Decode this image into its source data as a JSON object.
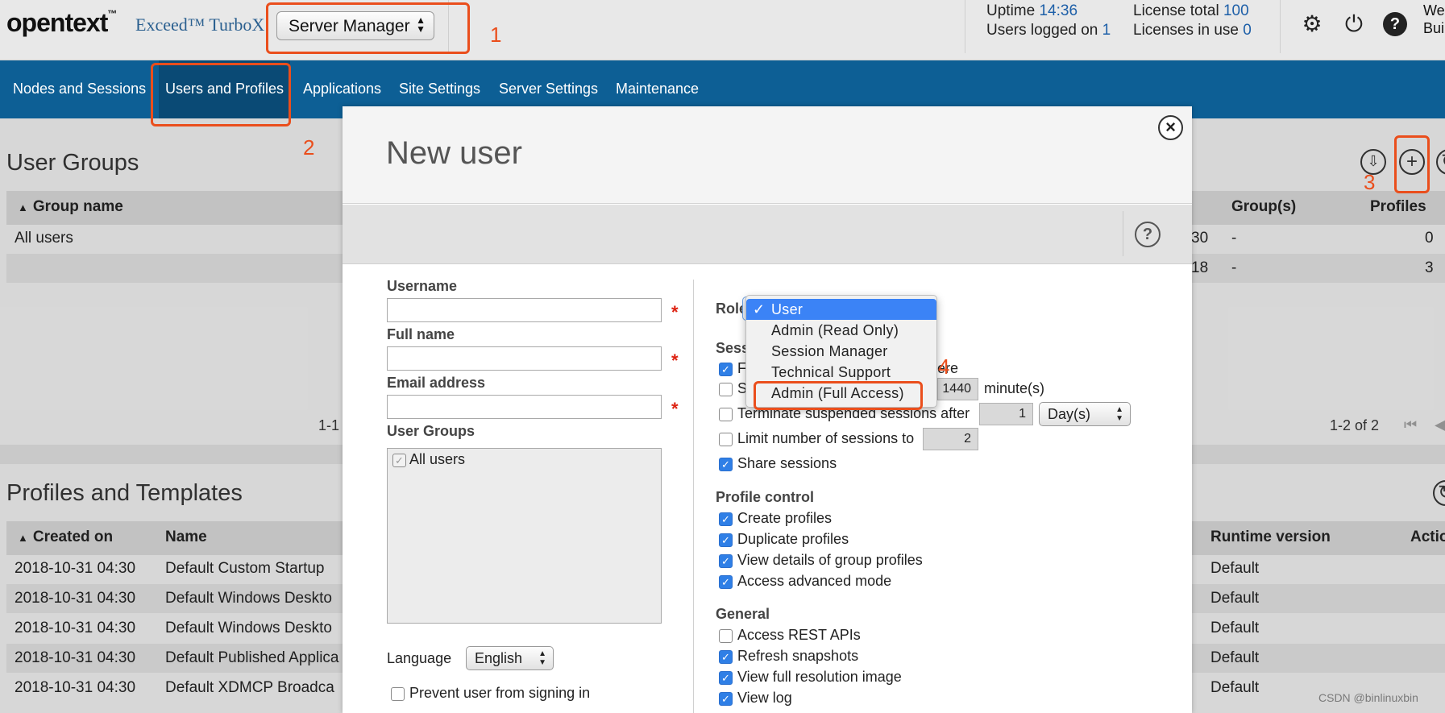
{
  "header": {
    "logo_main": "opentext",
    "logo_tm": "™",
    "logo_sub": "Exceed™ TurboX",
    "server_select": "Server Manager",
    "uptime_label": "Uptime",
    "uptime_value": "14:36",
    "users_logged_label": "Users logged on",
    "users_logged_value": "1",
    "license_total_label": "License total",
    "license_total_value": "100",
    "licenses_in_use_label": "Licenses in use",
    "licenses_in_use_value": "0",
    "welcome_line1": "We",
    "welcome_line2": "Bui"
  },
  "nav": {
    "items": [
      {
        "label": "Nodes and Sessions"
      },
      {
        "label": "Users and Profiles"
      },
      {
        "label": "Applications"
      },
      {
        "label": "Site Settings"
      },
      {
        "label": "Server Settings"
      },
      {
        "label": "Maintenance"
      }
    ],
    "active": "Users and Profiles"
  },
  "user_groups": {
    "title": "User Groups",
    "header_group_name": "Group name",
    "header_groups": "Group(s)",
    "header_profiles": "Profiles",
    "rows": [
      {
        "group": "All users",
        "mid": "30",
        "groups": "-",
        "profiles": "0"
      },
      {
        "group": "",
        "mid": "18",
        "groups": "-",
        "profiles": "3"
      }
    ],
    "pager_left": "1-1",
    "pager_right": "1-2 of 2"
  },
  "profiles": {
    "title": "Profiles and Templates",
    "header_created": "Created on",
    "header_name": "Name",
    "header_runtime": "Runtime version",
    "header_actions": "Actio",
    "rows": [
      {
        "created": "2018-10-31 04:30",
        "name": "Default Custom Startup",
        "runtime": "Default"
      },
      {
        "created": "2018-10-31 04:30",
        "name": "Default Windows Deskto",
        "runtime": "Default"
      },
      {
        "created": "2018-10-31 04:30",
        "name": "Default Windows Deskto",
        "runtime": "Default"
      },
      {
        "created": "2018-10-31 04:30",
        "name": "Default Published Applica",
        "runtime": "Default"
      },
      {
        "created": "2018-10-31 04:30",
        "name": "Default XDMCP Broadca",
        "runtime": "Default"
      }
    ]
  },
  "modal": {
    "title": "New user",
    "username_label": "Username",
    "fullname_label": "Full name",
    "email_label": "Email address",
    "required_mark": "*",
    "user_groups_label": "User Groups",
    "user_groups_item": "All users",
    "language_label": "Language",
    "language_value": "English",
    "prevent_signin": "Prevent user from signing in",
    "role_label": "Role",
    "sessions_label": "Sess",
    "sess_row1_prefix": "F",
    "sess_row1_suffix": "ere",
    "sess_row2_prefix": "S",
    "timeout_value": "1440",
    "timeout_unit": "minute(s)",
    "terminate_label": "Terminate suspended sessions after",
    "terminate_value": "1",
    "terminate_unit": "Day(s)",
    "limit_label": "Limit number of sessions to",
    "limit_value": "2",
    "share_sessions": "Share sessions",
    "profile_control_label": "Profile control",
    "profile_items": [
      "Create profiles",
      "Duplicate profiles",
      "View details of group profiles",
      "Access advanced mode"
    ],
    "general_label": "General",
    "general_items": [
      {
        "label": "Access REST APIs",
        "checked": false
      },
      {
        "label": "Refresh snapshots",
        "checked": true
      },
      {
        "label": "View full resolution image",
        "checked": true
      },
      {
        "label": "View log",
        "checked": true
      }
    ]
  },
  "role_dropdown": {
    "check": "✓",
    "options": [
      "User",
      "Admin (Read Only)",
      "Session Manager",
      "Technical Support",
      "Admin (Full Access)"
    ],
    "selected": "User"
  },
  "annotations": {
    "n1": "1",
    "n2": "2",
    "n3": "3",
    "n4": "4",
    "color": "#ea4e1c"
  },
  "watermark": "CSDN @binlinuxbin"
}
